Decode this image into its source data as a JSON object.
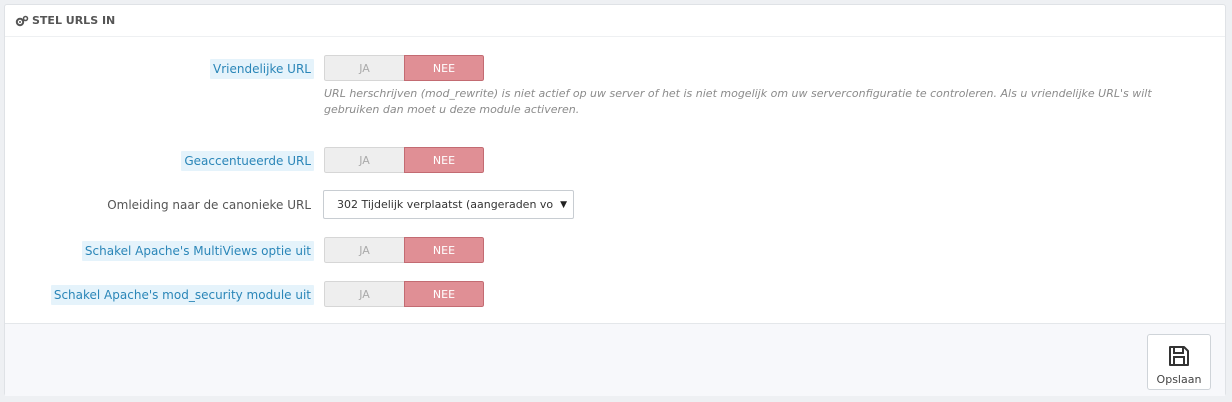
{
  "panel": {
    "title": "STEL URLS IN",
    "title_icon": "cogs-icon"
  },
  "fields": {
    "friendly_url": {
      "label": "Vriendelijke URL",
      "yes": "JA",
      "no": "NEE",
      "selected": "NEE",
      "help": "URL herschrijven (mod_rewrite) is niet actief op uw server of het is niet mogelijk om uw serverconfiguratie te controleren. Als u vriendelijke URL's wilt gebruiken dan moet u deze module activeren."
    },
    "accented_url": {
      "label": "Geaccentueerde URL",
      "yes": "JA",
      "no": "NEE",
      "selected": "NEE"
    },
    "canonical_redirect": {
      "label": "Omleiding naar de canonieke URL",
      "value": "302 Tijdelijk verplaatst (aangeraden vo"
    },
    "multiviews": {
      "label": "Schakel Apache's MultiViews optie uit",
      "yes": "JA",
      "no": "NEE",
      "selected": "NEE"
    },
    "mod_security": {
      "label": "Schakel Apache's mod_security module uit",
      "yes": "JA",
      "no": "NEE",
      "selected": "NEE"
    }
  },
  "footer": {
    "save_label": "Opslaan",
    "save_icon": "floppy-disk-icon"
  },
  "colors": {
    "switch_no_active": "#e08f95",
    "hint_label_bg": "#e5f3fb",
    "hint_label_text": "#2a86b8"
  }
}
